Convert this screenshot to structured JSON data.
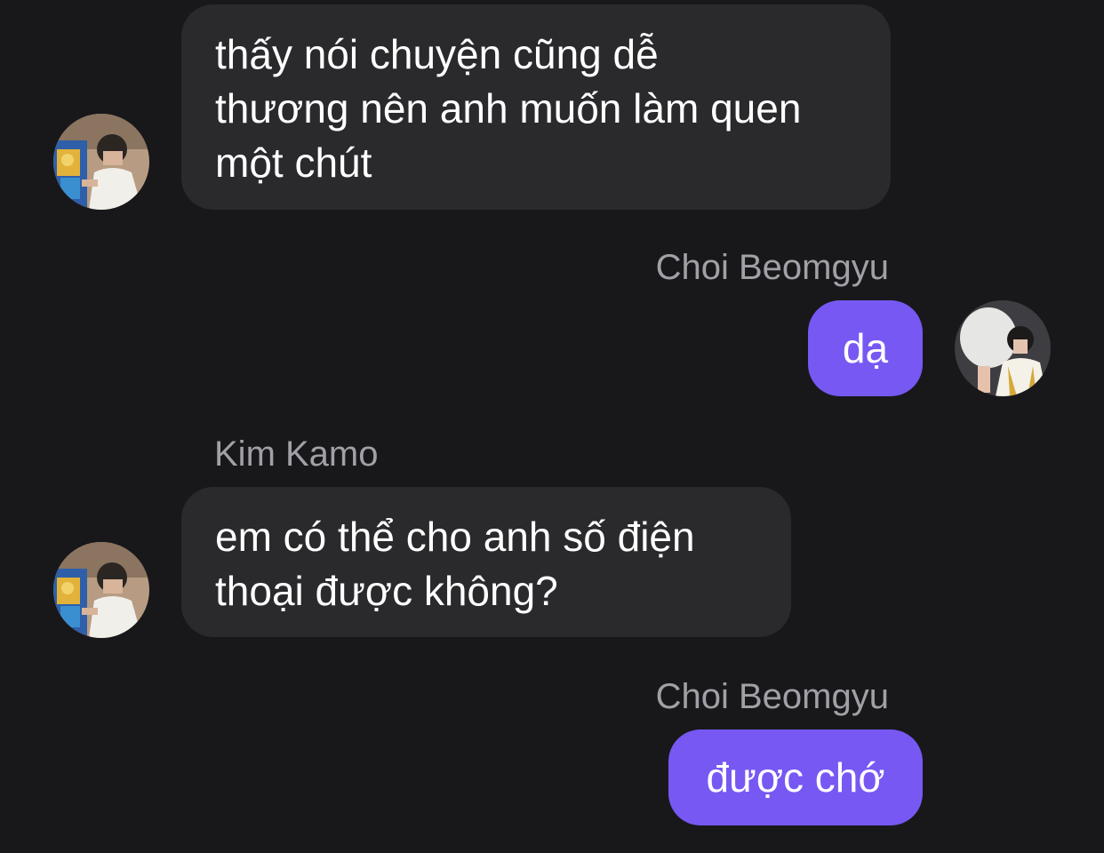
{
  "messages": [
    {
      "sender": "",
      "text": "thấy nói chuyện cũng dễ\nthương nên anh muốn làm quen\nmột chút",
      "direction": "incoming"
    },
    {
      "sender": "Choi Beomgyu",
      "text": "dạ",
      "direction": "outgoing"
    },
    {
      "sender": "Kim Kamo",
      "text": "em có thể cho anh số điện\nthoại được không?",
      "direction": "incoming"
    },
    {
      "sender": "Choi Beomgyu",
      "text": "được chớ",
      "direction": "outgoing"
    }
  ],
  "colors": {
    "background": "#18181b",
    "incoming_bubble": "#2a2a2d",
    "outgoing_bubble": "#7758f2",
    "sender_name": "#a0a0a6"
  }
}
